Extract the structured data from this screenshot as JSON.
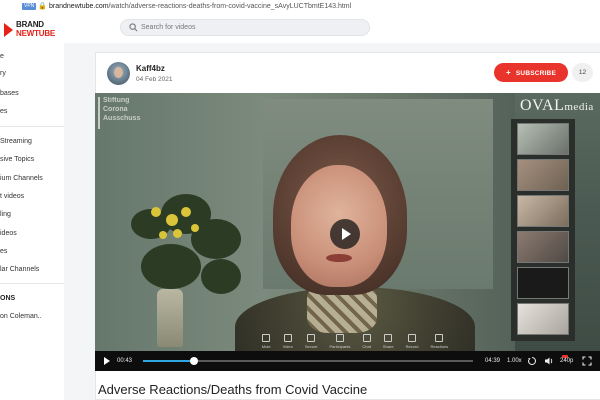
{
  "browser": {
    "vpn_badge": "VPN",
    "url_host": "brandnewtube.com",
    "url_path": "/watch/adverse-reactions-deaths-from-covid-vaccine_sAvyLUCTbmtE143.html"
  },
  "site": {
    "logo_line1": "BRAND",
    "logo_line2": "NEWTUBE",
    "search_placeholder": "Search for videos"
  },
  "sidebar": {
    "items": [
      {
        "label": "e"
      },
      {
        "label": "ry"
      },
      {
        "label": "bases"
      },
      {
        "label": "es"
      },
      {
        "label": "Streaming"
      },
      {
        "label": "sive Topics"
      },
      {
        "label": "ium Channels"
      },
      {
        "label": "t videos"
      },
      {
        "label": "ling"
      },
      {
        "label": "ideos"
      },
      {
        "label": "es"
      },
      {
        "label": "lar Channels"
      }
    ],
    "section_title": "ONS",
    "section_items": [
      {
        "label": "on Coleman.."
      }
    ]
  },
  "video": {
    "uploader": "Kaff4bz",
    "date": "04 Feb 2021",
    "subscribe_label": "SUBSCRIBE",
    "subscriber_count": "12",
    "title": "Adverse Reactions/Deaths from Covid Vaccine",
    "overlay_top_left": [
      "Stiftung",
      "Corona",
      "Ausschuss"
    ],
    "watermark": "OVAL",
    "watermark_suffix": "media",
    "current_time": "00:43",
    "duration": "04:39",
    "speed": "1.00x",
    "quality": "240p",
    "progress_fraction": 0.154,
    "zoom_toolbar": [
      "Mute",
      "Video",
      "Secure",
      "Participants",
      "Chat",
      "Share",
      "Record",
      "Reactions"
    ]
  },
  "colors": {
    "accent_red": "#e8342b",
    "progress_blue": "#2fa6e0"
  }
}
